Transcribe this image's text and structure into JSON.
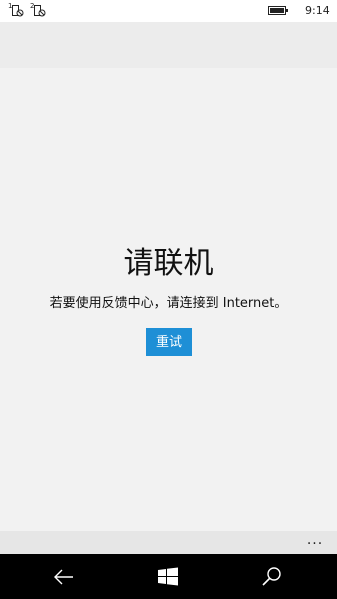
{
  "status_bar": {
    "sim1_number": "1",
    "sim2_number": "2",
    "time": "9:14"
  },
  "main": {
    "title": "请联机",
    "message": "若要使用反馈中心，请连接到 Internet。",
    "retry_label": "重试"
  },
  "app_bar": {
    "more_label": "..."
  },
  "nav": {
    "back_icon": "back-arrow-icon",
    "home_icon": "windows-logo-icon",
    "search_icon": "search-icon"
  },
  "colors": {
    "accent": "#1e8fd6",
    "background": "#f2f2f2"
  }
}
